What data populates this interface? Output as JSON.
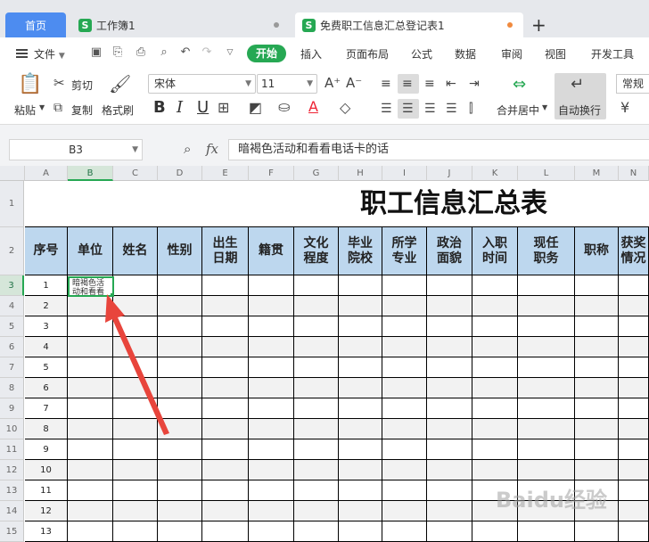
{
  "tabs": {
    "home": "首页",
    "doc1": "工作簿1",
    "active": "免费职工信息汇总登记表1",
    "doc_icon": "S",
    "new_tab": "+"
  },
  "menu": {
    "file": "文件",
    "items": [
      "开始",
      "插入",
      "页面布局",
      "公式",
      "数据",
      "审阅",
      "视图",
      "开发工具"
    ]
  },
  "ribbon": {
    "paste": "粘贴",
    "cut": "剪切",
    "copy": "复制",
    "format_painter": "格式刷",
    "font_name": "宋体",
    "font_size": "11",
    "merge_center": "合并居中",
    "auto_wrap": "自动换行",
    "number_style": "常规",
    "bold": "B",
    "italic": "I",
    "underline": "U"
  },
  "formula_bar": {
    "cell_ref": "B3",
    "fx": "fx",
    "content": "暗褐色活动和看看电话卡的话"
  },
  "sheet": {
    "columns": [
      "A",
      "B",
      "C",
      "D",
      "E",
      "F",
      "G",
      "H",
      "I",
      "J",
      "K",
      "L",
      "M",
      "N"
    ],
    "selected_column": "B",
    "title": "职工信息汇总表",
    "headers": [
      "序号",
      "单位",
      "姓名",
      "性别",
      "出生\n日期",
      "籍贯",
      "文化\n程度",
      "毕业\n院校",
      "所学\n专业",
      "政治\n面貌",
      "入职\n时间",
      "现任\n职务",
      "职称",
      "获奖\n情况"
    ],
    "row_numbers": [
      1,
      2,
      3,
      4,
      5,
      6,
      7,
      8,
      9,
      10,
      11,
      12,
      13,
      14,
      15
    ],
    "serials": [
      1,
      2,
      3,
      4,
      5,
      6,
      7,
      8,
      9,
      10,
      11,
      12,
      13
    ],
    "active_cell_text": "暗褐色活动和看看电话卡的话",
    "selected_row": 3
  },
  "colors": {
    "accent_green": "#26a853",
    "header_blue": "#bdd7ee",
    "tab_blue": "#4d8cf0",
    "arrow_red": "#e8453c"
  },
  "watermark": "Baidu经验"
}
